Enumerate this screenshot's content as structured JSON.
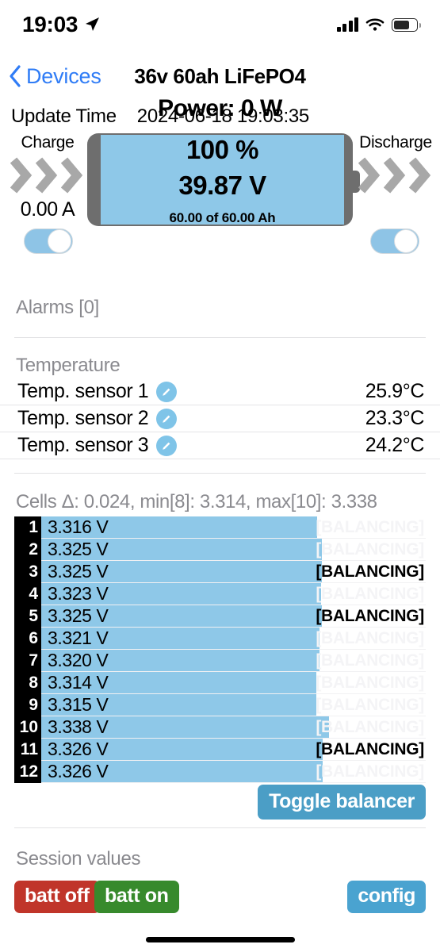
{
  "status_bar": {
    "time": "19:03",
    "icons": [
      "location-arrow-icon",
      "cellular-signal-icon",
      "wifi-icon",
      "battery-icon"
    ],
    "battery_level_pct": 60
  },
  "nav": {
    "back_label": "Devices",
    "title": "36v 60ah LiFePO4"
  },
  "update": {
    "label": "Update Time",
    "value": "2024-06-18 19:03:35"
  },
  "hero": {
    "charge_label": "Charge",
    "charge_amps": "0.00 A",
    "discharge_label": "Discharge",
    "percent": "100 %",
    "voltage": "39.87 V",
    "capacity": "60.00 of 60.00 Ah",
    "power": "Power: 0 W",
    "charge_switch_on": true,
    "discharge_switch_on": true
  },
  "alarms": {
    "header": "Alarms [0]"
  },
  "temperature": {
    "header": "Temperature",
    "rows": [
      {
        "name": "Temp. sensor 1",
        "value": "25.9°C"
      },
      {
        "name": "Temp. sensor 2",
        "value": "23.3°C"
      },
      {
        "name": "Temp. sensor 3",
        "value": "24.2°C"
      }
    ]
  },
  "cells": {
    "summary": "Cells Δ: 0.024, min[8]: 3.314, max[10]: 3.338",
    "delta": 0.024,
    "min_index": 8,
    "min_value": 3.314,
    "max_index": 10,
    "max_value": 3.338,
    "balancing_label": "[BALANCING]",
    "toggle_balancer_label": "Toggle balancer",
    "rows": [
      {
        "index": "1",
        "voltage": "3.316 V",
        "value": 3.316,
        "balancing": false
      },
      {
        "index": "2",
        "voltage": "3.325 V",
        "value": 3.325,
        "balancing": false
      },
      {
        "index": "3",
        "voltage": "3.325 V",
        "value": 3.325,
        "balancing": true
      },
      {
        "index": "4",
        "voltage": "3.323 V",
        "value": 3.323,
        "balancing": false
      },
      {
        "index": "5",
        "voltage": "3.325 V",
        "value": 3.325,
        "balancing": true
      },
      {
        "index": "6",
        "voltage": "3.321 V",
        "value": 3.321,
        "balancing": false
      },
      {
        "index": "7",
        "voltage": "3.320 V",
        "value": 3.32,
        "balancing": false
      },
      {
        "index": "8",
        "voltage": "3.314 V",
        "value": 3.314,
        "balancing": false
      },
      {
        "index": "9",
        "voltage": "3.315 V",
        "value": 3.315,
        "balancing": false
      },
      {
        "index": "10",
        "voltage": "3.338 V",
        "value": 3.338,
        "balancing": false
      },
      {
        "index": "11",
        "voltage": "3.326 V",
        "value": 3.326,
        "balancing": true
      },
      {
        "index": "12",
        "voltage": "3.326 V",
        "value": 3.326,
        "balancing": false
      }
    ]
  },
  "session": {
    "header": "Session values",
    "batt_off_label": "batt off",
    "batt_on_label": "batt on",
    "config_label": "config"
  },
  "colors": {
    "accent_blue": "#4b9ec6",
    "battery_fill": "#8ec8e8",
    "link_blue": "#2f7cf6",
    "muted_gray": "#8a8a8f",
    "danger_red": "#c0352a",
    "success_green": "#378a2c"
  }
}
